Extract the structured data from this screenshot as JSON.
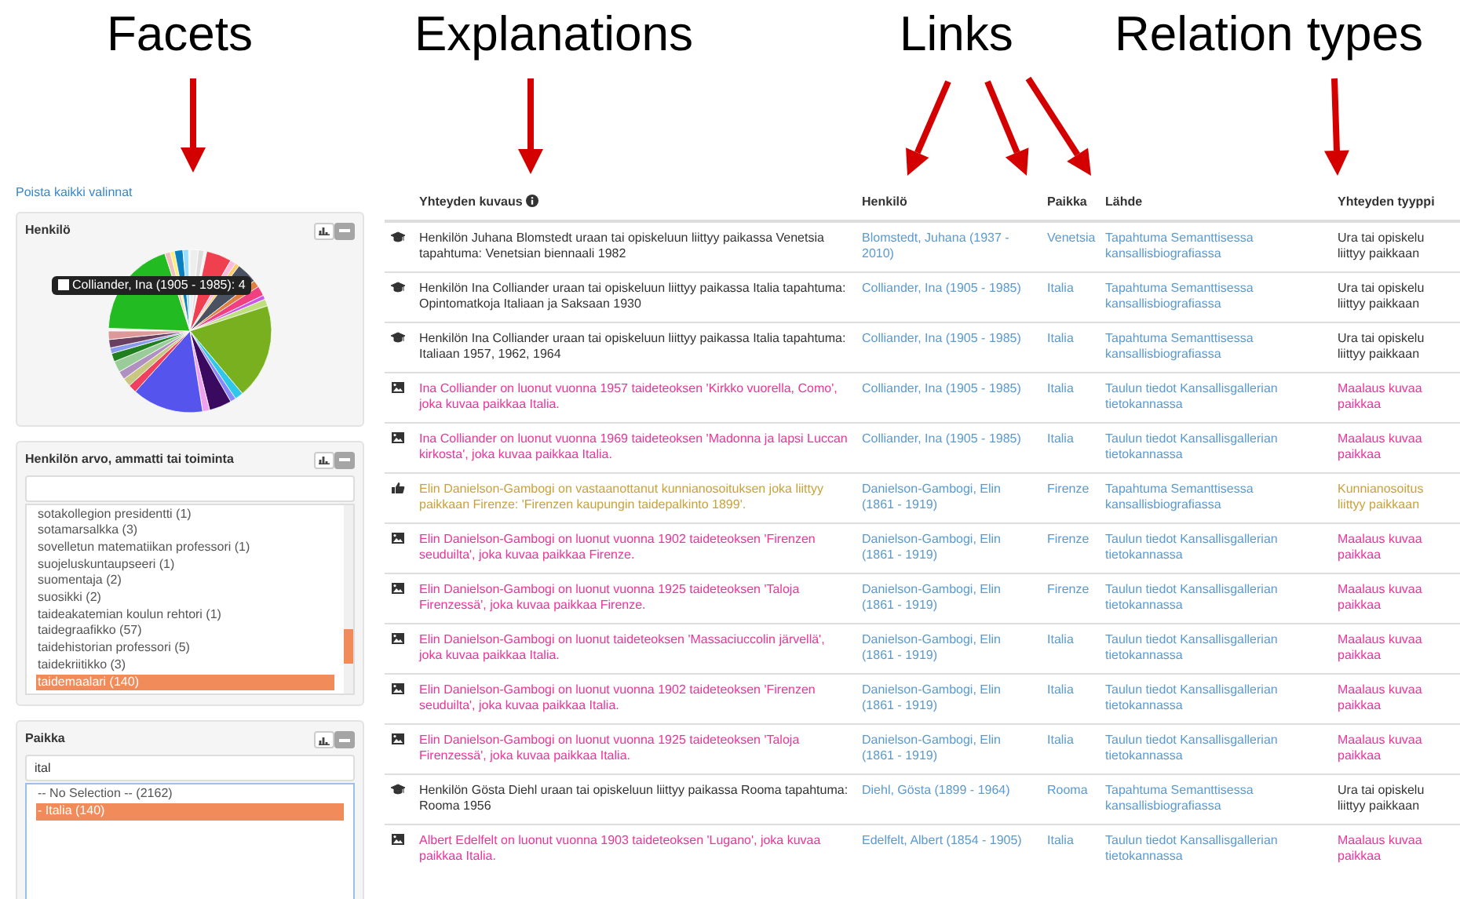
{
  "annotations": [
    {
      "label": "Facets"
    },
    {
      "label": "Explanations"
    },
    {
      "label": "Links"
    },
    {
      "label": "Relation types"
    }
  ],
  "clear_link": "Poista kaikki valinnat",
  "facets": [
    {
      "kind": "pie",
      "title": "Henkilö",
      "tooltip": "Colliander, Ina (1905 - 1985): 4"
    },
    {
      "kind": "list",
      "title": "Henkilön arvo, ammatti tai toiminta",
      "items": [
        {
          "label": "sotakollegion presidentti (1)",
          "selected": false
        },
        {
          "label": "sotamarsalkka (3)",
          "selected": false
        },
        {
          "label": "sovelletun matematiikan professori (1)",
          "selected": false
        },
        {
          "label": "suojeluskuntaupseeri (1)",
          "selected": false
        },
        {
          "label": "suomentaja (2)",
          "selected": false
        },
        {
          "label": "suosikki (2)",
          "selected": false
        },
        {
          "label": "taideakatemian koulun rehtori (1)",
          "selected": false
        },
        {
          "label": "taidegraafikko (57)",
          "selected": false
        },
        {
          "label": "taidehistorian professori (5)",
          "selected": false
        },
        {
          "label": "taidekriitikko (3)",
          "selected": false
        },
        {
          "label": "taidemaalari (140)",
          "selected": true
        }
      ]
    },
    {
      "kind": "list",
      "title": "Paikka",
      "search": {
        "value": "ital"
      },
      "items": [
        {
          "label": "-- No Selection -- (2162)",
          "selected": false
        },
        {
          "label": "- Italia (140)",
          "selected": true
        }
      ]
    }
  ],
  "table": {
    "columns": [
      "Yhteyden kuvaus",
      "Henkilö",
      "Paikka",
      "Lähde",
      "Yhteyden tyyppi"
    ],
    "rows": [
      {
        "kind": "career",
        "description": "Henkilön Juhana Blomstedt uraan tai opiskeluun liittyy paikassa Venetsia tapahtuma: Venetsian biennaali 1982",
        "person": "Blomstedt, Juhana (1937 - 2010)",
        "place": "Venetsia",
        "source": "Tapahtuma Semanttisessa kansallisbiografiassa",
        "relation_type": "Ura tai opiskelu liittyy paikkaan"
      },
      {
        "kind": "career",
        "description": "Henkilön Ina Colliander uraan tai opiskeluun liittyy paikassa Italia tapahtuma: Opintomatkoja Italiaan ja Saksaan 1930",
        "person": "Colliander, Ina (1905 - 1985)",
        "place": "Italia",
        "source": "Tapahtuma Semanttisessa kansallisbiografiassa",
        "relation_type": "Ura tai opiskelu liittyy paikkaan"
      },
      {
        "kind": "career",
        "description": "Henkilön Ina Colliander uraan tai opiskeluun liittyy paikassa Italia tapahtuma: Italiaan 1957, 1962, 1964",
        "person": "Colliander, Ina (1905 - 1985)",
        "place": "Italia",
        "source": "Tapahtuma Semanttisessa kansallisbiografiassa",
        "relation_type": "Ura tai opiskelu liittyy paikkaan"
      },
      {
        "kind": "artwork",
        "description": "Ina Colliander on luonut vuonna 1957 taideteoksen 'Kirkko vuorella, Como', joka kuvaa paikkaa Italia.",
        "person": "Colliander, Ina (1905 - 1985)",
        "place": "Italia",
        "source": "Taulun tiedot Kansallisgallerian tietokannassa",
        "relation_type": "Maalaus kuvaa paikkaa"
      },
      {
        "kind": "artwork",
        "description": "Ina Colliander on luonut vuonna 1969 taideteoksen 'Madonna ja lapsi Luccan kirkosta', joka kuvaa paikkaa Italia.",
        "person": "Colliander, Ina (1905 - 1985)",
        "place": "Italia",
        "source": "Taulun tiedot Kansallisgallerian tietokannassa",
        "relation_type": "Maalaus kuvaa paikkaa"
      },
      {
        "kind": "honor",
        "description": "Elin Danielson-Gambogi on vastaanottanut kunnianosoituksen joka liittyy paikkaan Firenze: 'Firenzen kaupungin taidepalkinto 1899'.",
        "person": "Danielson-Gambogi, Elin (1861 - 1919)",
        "place": "Firenze",
        "source": "Tapahtuma Semanttisessa kansallisbiografiassa",
        "relation_type": "Kunnianosoitus liittyy paikkaan"
      },
      {
        "kind": "artwork",
        "description": "Elin Danielson-Gambogi on luonut vuonna 1902 taideteoksen 'Firenzen seuduilta', joka kuvaa paikkaa Firenze.",
        "person": "Danielson-Gambogi, Elin (1861 - 1919)",
        "place": "Firenze",
        "source": "Taulun tiedot Kansallisgallerian tietokannassa",
        "relation_type": "Maalaus kuvaa paikkaa"
      },
      {
        "kind": "artwork",
        "description": "Elin Danielson-Gambogi on luonut vuonna 1925 taideteoksen 'Taloja Firenzessä', joka kuvaa paikkaa Firenze.",
        "person": "Danielson-Gambogi, Elin (1861 - 1919)",
        "place": "Firenze",
        "source": "Taulun tiedot Kansallisgallerian tietokannassa",
        "relation_type": "Maalaus kuvaa paikkaa"
      },
      {
        "kind": "artwork",
        "description": "Elin Danielson-Gambogi on luonut taideteoksen 'Massaciuccolin järvellä', joka kuvaa paikkaa Italia.",
        "person": "Danielson-Gambogi, Elin (1861 - 1919)",
        "place": "Italia",
        "source": "Taulun tiedot Kansallisgallerian tietokannassa",
        "relation_type": "Maalaus kuvaa paikkaa"
      },
      {
        "kind": "artwork",
        "description": "Elin Danielson-Gambogi on luonut vuonna 1902 taideteoksen 'Firenzen seuduilta', joka kuvaa paikkaa Italia.",
        "person": "Danielson-Gambogi, Elin (1861 - 1919)",
        "place": "Italia",
        "source": "Taulun tiedot Kansallisgallerian tietokannassa",
        "relation_type": "Maalaus kuvaa paikkaa"
      },
      {
        "kind": "artwork",
        "description": "Elin Danielson-Gambogi on luonut vuonna 1925 taideteoksen 'Taloja Firenzessä', joka kuvaa paikkaa Italia.",
        "person": "Danielson-Gambogi, Elin (1861 - 1919)",
        "place": "Italia",
        "source": "Taulun tiedot Kansallisgallerian tietokannassa",
        "relation_type": "Maalaus kuvaa paikkaa"
      },
      {
        "kind": "career",
        "description": "Henkilön Gösta Diehl uraan tai opiskeluun liittyy paikassa Rooma tapahtuma: Rooma 1956",
        "person": "Diehl, Gösta (1899 - 1964)",
        "place": "Rooma",
        "source": "Tapahtuma Semanttisessa kansallisbiografiassa",
        "relation_type": "Ura tai opiskelu liittyy paikkaan"
      },
      {
        "kind": "artwork",
        "description": "Albert Edelfelt on luonut vuonna 1903 taideteoksen 'Lugano', joka kuvaa paikkaa Italia.",
        "person": "Edelfelt, Albert (1854 - 1905)",
        "place": "Italia",
        "source": "Taulun tiedot Kansallisgallerian tietokannassa",
        "relation_type": "Maalaus kuvaa paikkaa"
      }
    ]
  }
}
